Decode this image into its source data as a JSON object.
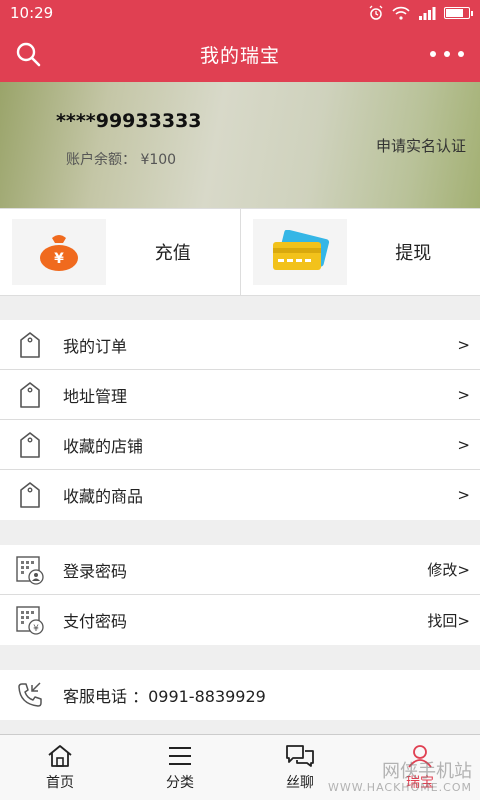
{
  "status_bar": {
    "time": "10:29"
  },
  "header": {
    "title": "我的瑞宝"
  },
  "account": {
    "number": "****99933333",
    "balance": "账户余额： ¥100",
    "verify_link": "申请实名认证"
  },
  "quick_actions": [
    {
      "label": "充值",
      "icon": "money-bag-icon"
    },
    {
      "label": "提现",
      "icon": "cards-icon"
    }
  ],
  "menu_group_1": [
    {
      "label": "我的订单",
      "action": ">"
    },
    {
      "label": "地址管理",
      "action": ">"
    },
    {
      "label": "收藏的店铺",
      "action": ">"
    },
    {
      "label": "收藏的商品",
      "action": ">"
    }
  ],
  "menu_group_2": [
    {
      "label": "登录密码",
      "action": "修改>"
    },
    {
      "label": "支付密码",
      "action": "找回>"
    }
  ],
  "service": {
    "label": "客服电话 ：0991-8839929"
  },
  "tabs": [
    {
      "label": "首页"
    },
    {
      "label": "分类"
    },
    {
      "label": "丝聊"
    },
    {
      "label": "瑞宝"
    }
  ],
  "watermark": {
    "text": "网侠手机站",
    "sub": "WWW.HACKHOME.COM"
  },
  "colors": {
    "brand": "#e04052",
    "accent_orange": "#f06a1e",
    "card_yellow": "#f2c21b"
  }
}
